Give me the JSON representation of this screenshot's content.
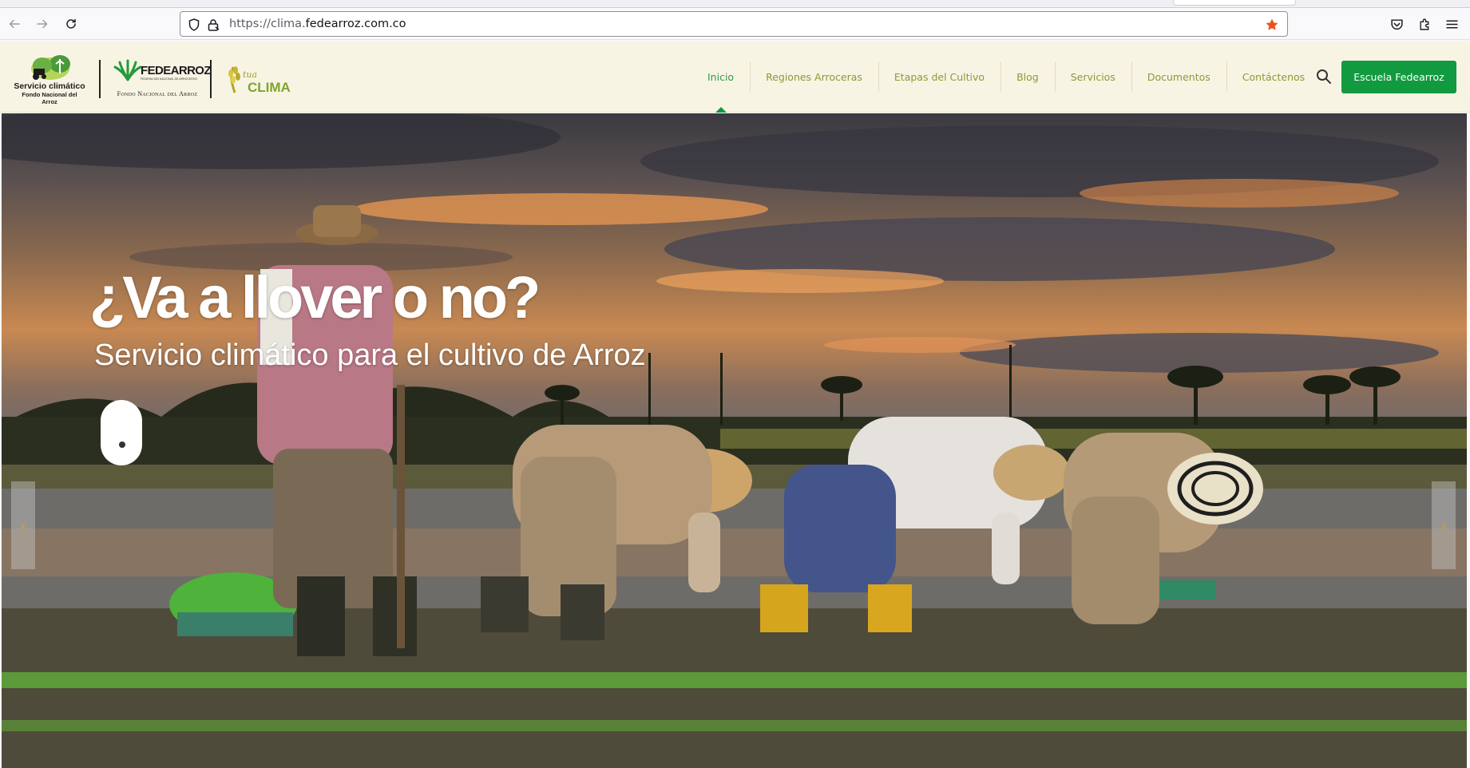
{
  "browser": {
    "url_prefix": "https://clima.",
    "url_domain": "fedearroz.com.co",
    "icons": [
      "back-icon",
      "forward-icon",
      "reload-icon",
      "shield-icon",
      "lock-icon",
      "bookmark-star-icon",
      "pocket-icon",
      "extensions-icon",
      "menu-icon"
    ],
    "star_color": "#e8541c"
  },
  "header": {
    "logo_clima_line1": "Servicio climático",
    "logo_clima_line2": "Fondo Nacional del Arroz",
    "logo_fede_word": "FEDEARROZ",
    "logo_fede_small": "FEDERACIÓN NACIONAL DE ARROCEROS",
    "logo_fede_sub": "Fondo Nacional del Arroz",
    "logo_tu": "tua",
    "logo_clima": "CLIMA",
    "nav": [
      {
        "label": "Inicio",
        "active": true
      },
      {
        "label": "Regiones Arroceras",
        "active": false
      },
      {
        "label": "Etapas del Cultivo",
        "active": false
      },
      {
        "label": "Blog",
        "active": false
      },
      {
        "label": "Servicios",
        "active": false
      },
      {
        "label": "Documentos",
        "active": false
      },
      {
        "label": "Contáctenos",
        "active": false
      }
    ],
    "cta_label": "Escuela Fedearroz",
    "accent_color": "#119a3f",
    "nav_color": "#8a9a36"
  },
  "hero": {
    "title": "¿Va a llover o no?",
    "subtitle": "Servicio climático para el cultivo de Arroz",
    "prev_arrow": "‹",
    "next_arrow": "›"
  }
}
